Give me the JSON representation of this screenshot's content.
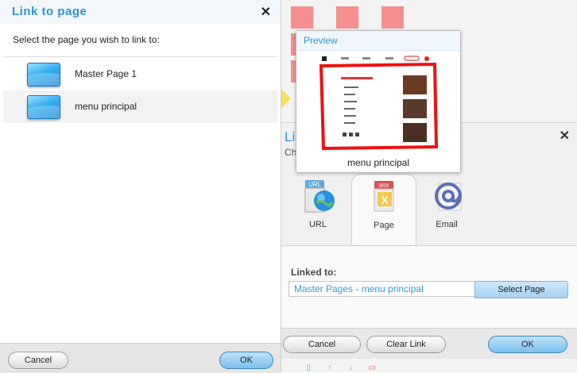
{
  "link_to_page_dialog": {
    "title": "Link to page",
    "instruction": "Select the page you wish to link to:",
    "pages": [
      {
        "label": "Master Page 1",
        "selected": false
      },
      {
        "label": "menu principal",
        "selected": true
      }
    ],
    "cancel_label": "Cancel",
    "ok_label": "OK",
    "close_icon": "close-icon"
  },
  "preview": {
    "title": "Preview",
    "caption": "menu principal"
  },
  "link_dialog": {
    "title_fragment": "Li",
    "subtitle_fragment": "Ch",
    "tabs": [
      {
        "label": "URL",
        "icon": "globe-icon",
        "active": false
      },
      {
        "label": "Page",
        "icon": "wix-page-icon",
        "active": true
      },
      {
        "label": "Email",
        "icon": "email-at-icon",
        "active": false
      }
    ],
    "linked_to_label": "Linked to:",
    "linked_to_value": "Master Pages - menu principal",
    "select_page_label": "Select Page",
    "cancel_label": "Cancel",
    "clear_link_label": "Clear Link",
    "ok_label": "OK"
  },
  "colors": {
    "accent_blue": "#2f93d6",
    "link_value": "#2f9bd6",
    "pink_marker": "#f58e8e"
  }
}
